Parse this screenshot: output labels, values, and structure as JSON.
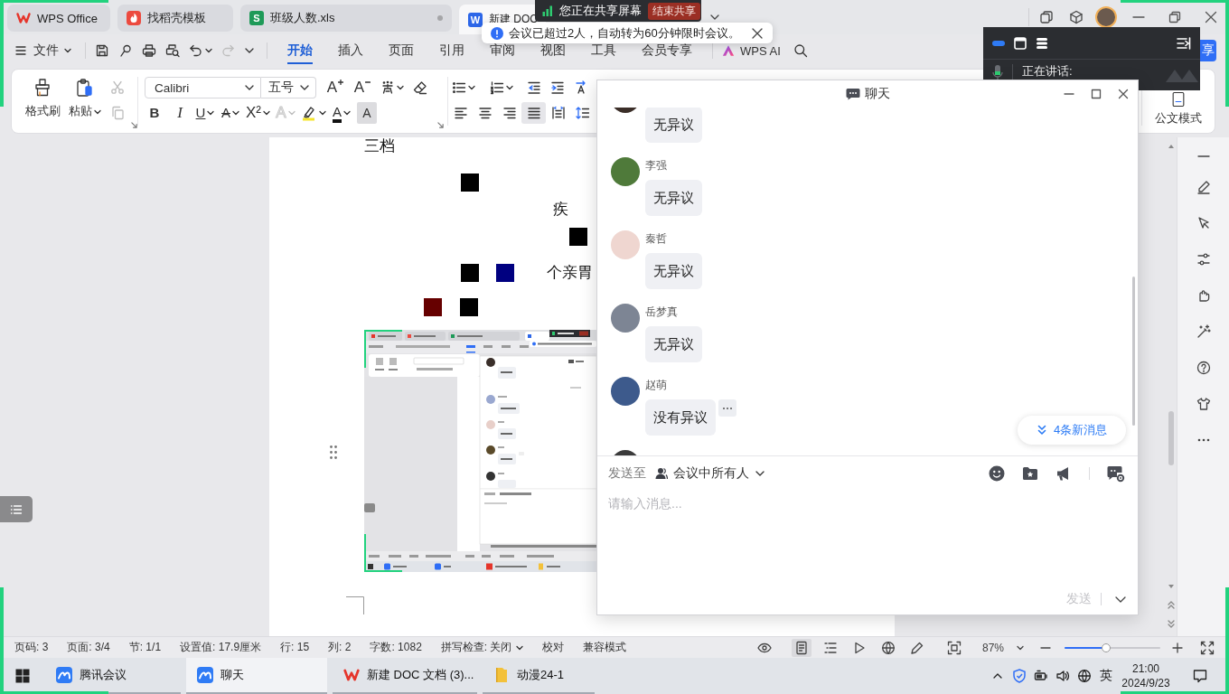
{
  "title_bar": {
    "tabs": [
      {
        "kind": "wps",
        "label": "WPS Office",
        "selected": false,
        "unsaved": false
      },
      {
        "kind": "docer",
        "label": "找稻壳模板",
        "selected": false,
        "unsaved": false
      },
      {
        "kind": "sheet",
        "icon_text": "S",
        "label": "班级人数.xls",
        "selected": false,
        "unsaved": true
      },
      {
        "kind": "writer",
        "icon_text": "W",
        "label": "新建 DOC",
        "selected": true,
        "unsaved": false
      }
    ]
  },
  "share_banner": {
    "text": "您正在共享屏幕",
    "stop_button": "结束共享"
  },
  "notice": {
    "text": "会议已超过2人，自动转为60分钟限时会议。"
  },
  "menu_bar": {
    "file_menu": "文件",
    "quick_access": [
      {
        "kind": "save",
        "disabled": false
      },
      {
        "kind": "export",
        "disabled": false
      },
      {
        "kind": "print",
        "disabled": false
      },
      {
        "kind": "preview",
        "disabled": false
      },
      {
        "kind": "undo",
        "disabled": false
      },
      {
        "kind": "redo",
        "disabled": true
      }
    ],
    "tabs": [
      {
        "label": "开始",
        "selected": true
      },
      {
        "label": "插入",
        "selected": false
      },
      {
        "label": "页面",
        "selected": false
      },
      {
        "label": "引用",
        "selected": false
      },
      {
        "label": "审阅",
        "selected": false
      },
      {
        "label": "视图",
        "selected": false
      },
      {
        "label": "工具",
        "selected": false
      },
      {
        "label": "会员专享",
        "selected": false
      }
    ],
    "ai_button": "WPS AI",
    "share_button": "享"
  },
  "meeting_panel": {
    "speaking": "正在讲话:"
  },
  "ribbon": {
    "format_painter": "格式刷",
    "paste": "粘贴",
    "clipboard_tools": [
      {
        "kind": "cut",
        "disabled": true
      },
      {
        "kind": "copy",
        "disabled": true
      }
    ],
    "font_name": "Calibri",
    "font_size": "五号",
    "size_tools": [
      {
        "kind": "grow",
        "label": "A"
      },
      {
        "kind": "shrink",
        "label": "A"
      }
    ],
    "format_tools": [
      {
        "kind": "bold",
        "label": "B",
        "disabled": false
      },
      {
        "kind": "italic",
        "label": "I",
        "disabled": false
      },
      {
        "kind": "underline",
        "label": "U",
        "disabled": false
      },
      {
        "kind": "strike",
        "label": "A",
        "disabled": false
      },
      {
        "kind": "superscript",
        "label": "X²",
        "disabled": false
      },
      {
        "kind": "effect",
        "label": "A",
        "disabled": true
      },
      {
        "kind": "highlight",
        "disabled": false
      },
      {
        "kind": "font_color",
        "label": "A",
        "disabled": false
      },
      {
        "kind": "shading",
        "label": "A",
        "disabled": false
      }
    ],
    "align_tools": [
      {
        "kind": "left",
        "selected": false
      },
      {
        "kind": "center",
        "selected": false
      },
      {
        "kind": "right",
        "selected": false
      },
      {
        "kind": "justify",
        "selected": true
      },
      {
        "kind": "distributed",
        "selected": false
      },
      {
        "kind": "spacing",
        "selected": false
      }
    ],
    "doc_mode": "公文模式"
  },
  "document": {
    "lines": [
      {
        "parts": [
          {
            "kind": "text",
            "text": "三档"
          }
        ]
      },
      {
        "parts": [
          {
            "kind": "block",
            "color": "#000000"
          }
        ]
      },
      {
        "parts": [
          {
            "kind": "text",
            "text": "疾"
          }
        ]
      },
      {
        "parts": [
          {
            "kind": "block",
            "color": "#000000"
          }
        ]
      },
      {
        "parts": [
          {
            "kind": "block",
            "color": "#000000"
          },
          {
            "kind": "block",
            "color": "#000080"
          },
          {
            "kind": "text",
            "text": "个亲胃"
          }
        ]
      },
      {
        "parts": [
          {
            "kind": "block",
            "color": "#660000"
          },
          {
            "kind": "block",
            "color": "#000000"
          }
        ]
      }
    ]
  },
  "chat": {
    "title": "聊天",
    "messages": [
      {
        "text": "无异议",
        "color": "#3b2e28",
        "show_more": false
      },
      {
        "name": "李强",
        "text": "无异议",
        "color": "#4f7a3a",
        "show_more": false
      },
      {
        "name": "秦哲",
        "text": "无异议",
        "color": "#efd6d0",
        "show_more": false
      },
      {
        "name": "岳梦真",
        "text": "无异议",
        "color": "#7d8594",
        "show_more": false
      },
      {
        "name": "赵萌",
        "text": "没有异议",
        "color": "#3d5a8c",
        "show_more": true
      },
      {
        "color": "#3a3a3a",
        "show_more": false
      }
    ],
    "new_messages": "4条新消息",
    "send_to_label": "发送至",
    "recipient": "会议中所有人",
    "placeholder": "请输入消息...",
    "send_button": {
      "label": "发送",
      "disabled": true
    }
  },
  "status_bar": {
    "items": [
      {
        "kind": "text",
        "label": "页码: 3"
      },
      {
        "kind": "text",
        "label": "页面: 3/4"
      },
      {
        "kind": "text",
        "label": "节: 1/1"
      },
      {
        "kind": "text",
        "label": "设置值: 17.9厘米"
      },
      {
        "kind": "text",
        "label": "行: 15"
      },
      {
        "kind": "text",
        "label": "列: 2"
      },
      {
        "kind": "text",
        "label": "字数: 1082"
      },
      {
        "kind": "menu",
        "label": "拼写检查: 关闭"
      },
      {
        "kind": "button",
        "label": "校对"
      },
      {
        "kind": "button",
        "label": "兼容模式"
      }
    ],
    "views": [
      {
        "kind": "reading",
        "selected": false
      },
      {
        "kind": "page",
        "selected": true
      },
      {
        "kind": "outline",
        "selected": false
      },
      {
        "kind": "play",
        "selected": false
      },
      {
        "kind": "web",
        "selected": false
      },
      {
        "kind": "pen",
        "selected": false
      }
    ],
    "zoom": "87%",
    "zoom_slider": {
      "level": 0.43
    }
  },
  "taskbar": {
    "apps": [
      {
        "kind": "meeting",
        "label": "腾讯会议",
        "selected": false
      },
      {
        "kind": "meeting",
        "label": "聊天",
        "selected": true
      },
      {
        "kind": "wps",
        "label": "新建 DOC 文档 (3)...",
        "selected": false
      },
      {
        "kind": "folder",
        "label": "动漫24-1",
        "selected": false
      }
    ],
    "ime": "英",
    "time": "21:00",
    "date": "2024/9/23"
  }
}
